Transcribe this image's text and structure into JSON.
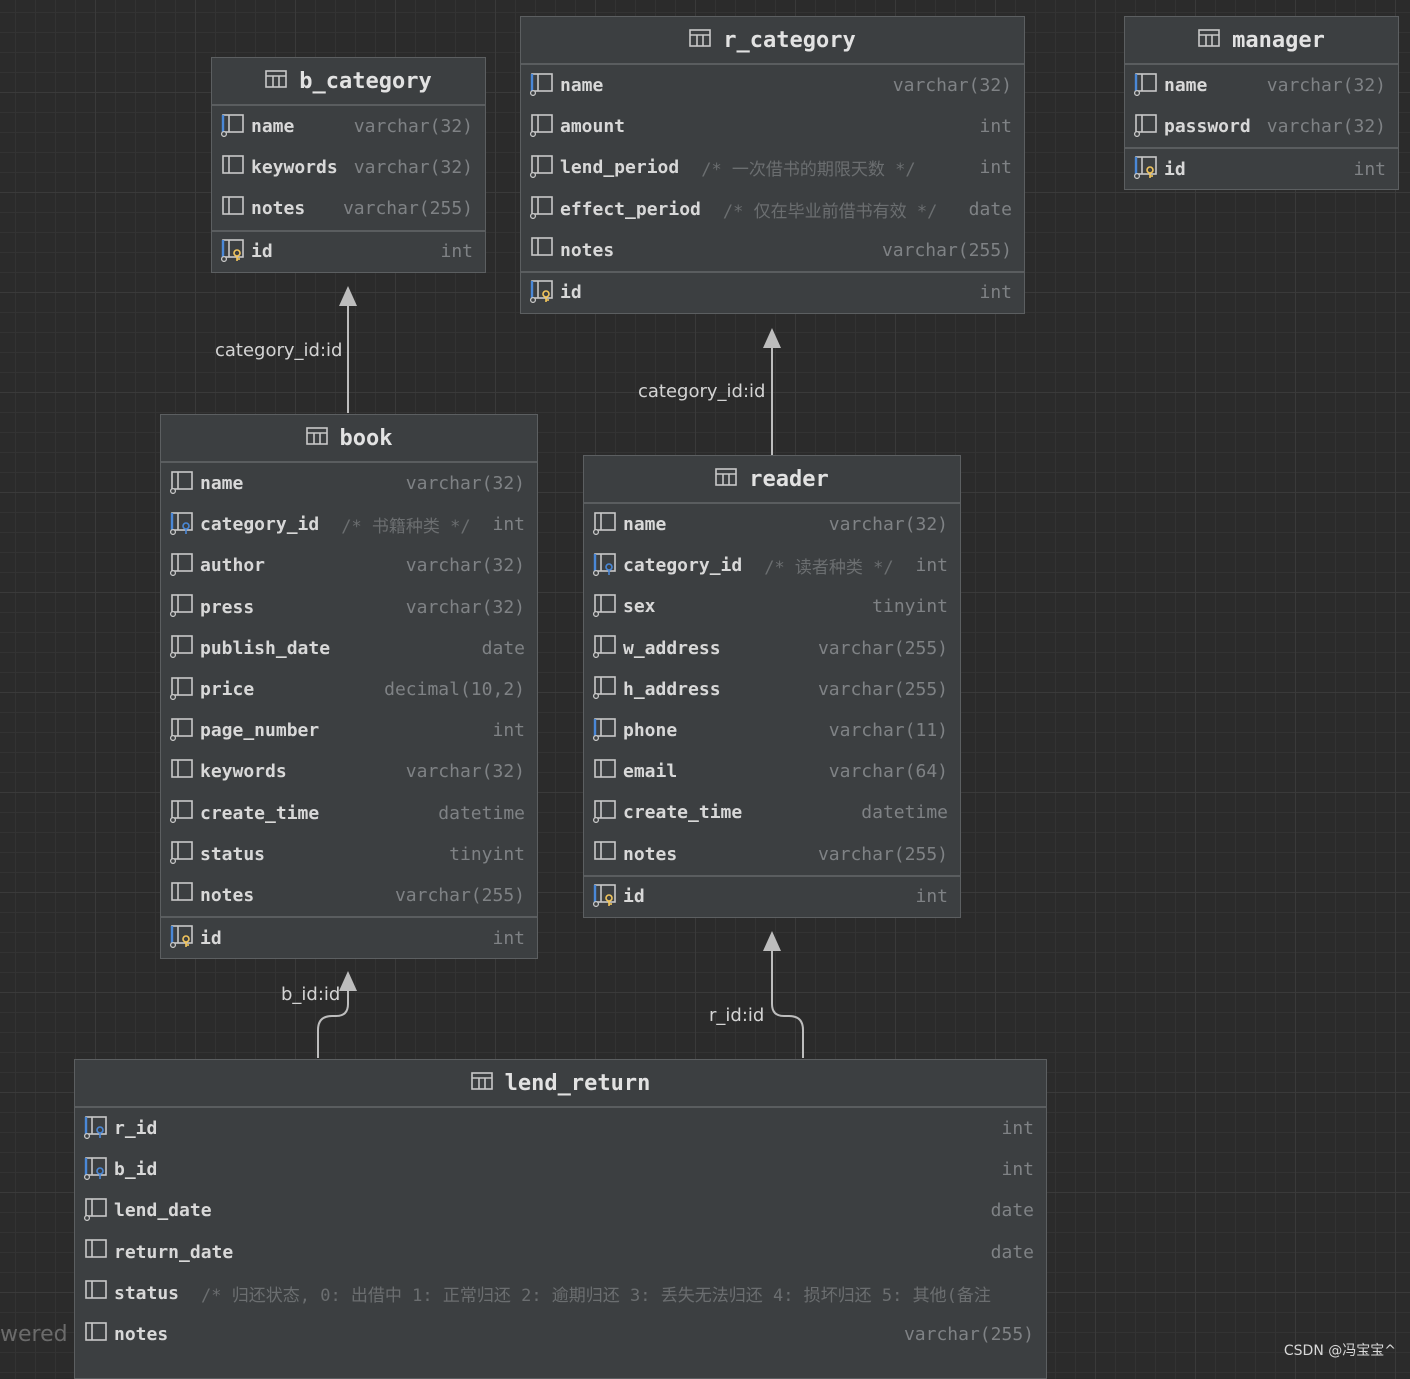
{
  "tables": {
    "b_category": {
      "name": "b_category",
      "columns": [
        {
          "name": "name",
          "comment": "",
          "type": "varchar(32)",
          "key": "index"
        },
        {
          "name": "keywords",
          "comment": "",
          "type": "varchar(32)",
          "key": "none"
        },
        {
          "name": "notes",
          "comment": "",
          "type": "varchar(255)",
          "key": "none"
        }
      ],
      "pk": {
        "name": "id",
        "type": "int"
      }
    },
    "r_category": {
      "name": "r_category",
      "columns": [
        {
          "name": "name",
          "comment": "",
          "type": "varchar(32)",
          "key": "index"
        },
        {
          "name": "amount",
          "comment": "",
          "type": "int",
          "key": "plain"
        },
        {
          "name": "lend_period",
          "comment": "/* 一次借书的期限天数 */",
          "type": "int",
          "key": "plain"
        },
        {
          "name": "effect_period",
          "comment": "/* 仅在毕业前借书有效 */",
          "type": "date",
          "key": "plain"
        },
        {
          "name": "notes",
          "comment": "",
          "type": "varchar(255)",
          "key": "none"
        }
      ],
      "pk": {
        "name": "id",
        "type": "int"
      }
    },
    "manager": {
      "name": "manager",
      "columns": [
        {
          "name": "name",
          "comment": "",
          "type": "varchar(32)",
          "key": "index"
        },
        {
          "name": "password",
          "comment": "",
          "type": "varchar(32)",
          "key": "plain"
        }
      ],
      "pk": {
        "name": "id",
        "type": "int"
      }
    },
    "book": {
      "name": "book",
      "columns": [
        {
          "name": "name",
          "comment": "",
          "type": "varchar(32)",
          "key": "plain"
        },
        {
          "name": "category_id",
          "comment": "/* 书籍种类 */",
          "type": "int",
          "key": "fk"
        },
        {
          "name": "author",
          "comment": "",
          "type": "varchar(32)",
          "key": "plain"
        },
        {
          "name": "press",
          "comment": "",
          "type": "varchar(32)",
          "key": "plain"
        },
        {
          "name": "publish_date",
          "comment": "",
          "type": "date",
          "key": "plain"
        },
        {
          "name": "price",
          "comment": "",
          "type": "decimal(10,2)",
          "key": "plain"
        },
        {
          "name": "page_number",
          "comment": "",
          "type": "int",
          "key": "plain"
        },
        {
          "name": "keywords",
          "comment": "",
          "type": "varchar(32)",
          "key": "none"
        },
        {
          "name": "create_time",
          "comment": "",
          "type": "datetime",
          "key": "plain"
        },
        {
          "name": "status",
          "comment": "",
          "type": "tinyint",
          "key": "plain"
        },
        {
          "name": "notes",
          "comment": "",
          "type": "varchar(255)",
          "key": "none"
        }
      ],
      "pk": {
        "name": "id",
        "type": "int"
      }
    },
    "reader": {
      "name": "reader",
      "columns": [
        {
          "name": "name",
          "comment": "",
          "type": "varchar(32)",
          "key": "plain"
        },
        {
          "name": "category_id",
          "comment": "/* 读者种类 */",
          "type": "int",
          "key": "fk"
        },
        {
          "name": "sex",
          "comment": "",
          "type": "tinyint",
          "key": "plain"
        },
        {
          "name": "w_address",
          "comment": "",
          "type": "varchar(255)",
          "key": "plain"
        },
        {
          "name": "h_address",
          "comment": "",
          "type": "varchar(255)",
          "key": "plain"
        },
        {
          "name": "phone",
          "comment": "",
          "type": "varchar(11)",
          "key": "index"
        },
        {
          "name": "email",
          "comment": "",
          "type": "varchar(64)",
          "key": "none"
        },
        {
          "name": "create_time",
          "comment": "",
          "type": "datetime",
          "key": "plain"
        },
        {
          "name": "notes",
          "comment": "",
          "type": "varchar(255)",
          "key": "none"
        }
      ],
      "pk": {
        "name": "id",
        "type": "int"
      }
    },
    "lend_return": {
      "name": "lend_return",
      "columns": [
        {
          "name": "r_id",
          "comment": "",
          "type": "int",
          "key": "fk"
        },
        {
          "name": "b_id",
          "comment": "",
          "type": "int",
          "key": "fk"
        },
        {
          "name": "lend_date",
          "comment": "",
          "type": "date",
          "key": "plain"
        },
        {
          "name": "return_date",
          "comment": "",
          "type": "date",
          "key": "none"
        },
        {
          "name": "status",
          "comment": "/* 归还状态, 0: 出借中  1: 正常归还  2: 逾期归还  3: 丢失无法归还  4: 损坏归还  5: 其他(备注",
          "type": "",
          "key": "none"
        },
        {
          "name": "notes",
          "comment": "",
          "type": "varchar(255)",
          "key": "none"
        }
      ],
      "pk": null
    }
  },
  "relations": [
    {
      "from": "book",
      "to": "b_category",
      "label": "category_id:id"
    },
    {
      "from": "reader",
      "to": "r_category",
      "label": "category_id:id"
    },
    {
      "from": "lend_return",
      "to": "book",
      "label": "b_id:id"
    },
    {
      "from": "lend_return",
      "to": "reader",
      "label": "r_id:id"
    }
  ],
  "background_text": "wered",
  "watermark": "CSDN @冯宝宝^",
  "colors": {
    "canvas": "#2b2b2b",
    "table": "#3c3f41",
    "key": "#f2c55c",
    "index": "#4a88d8"
  }
}
